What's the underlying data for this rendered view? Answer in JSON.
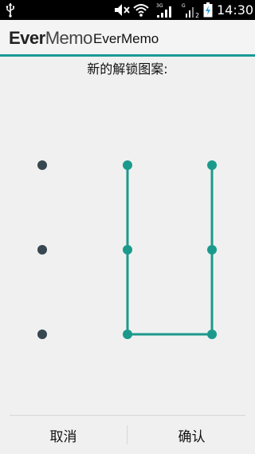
{
  "status_bar": {
    "time": "14:30",
    "icons": [
      "usb-icon",
      "mute-icon",
      "wifi-icon",
      "signal-3g-icon",
      "signal-g-icon",
      "battery-charging-icon"
    ],
    "signal1_label": "3G",
    "signal2_label": "G",
    "signal2_sub": "2"
  },
  "action_bar": {
    "logo_text_bold": "Ever",
    "logo_text_light": "Memo",
    "title": "EverMemo",
    "accent_color": "#1b9a95"
  },
  "prompt": "新的解锁图案:",
  "pattern": {
    "grid": "3x3",
    "selected_sequence": [
      "r1c2",
      "r2c2",
      "r3c2",
      "r3c3",
      "r2c3",
      "r1c3"
    ],
    "dot_color": "#37474f",
    "active_color": "#1b9a8c"
  },
  "buttons": {
    "cancel_label": "取消",
    "confirm_label": "确认"
  }
}
